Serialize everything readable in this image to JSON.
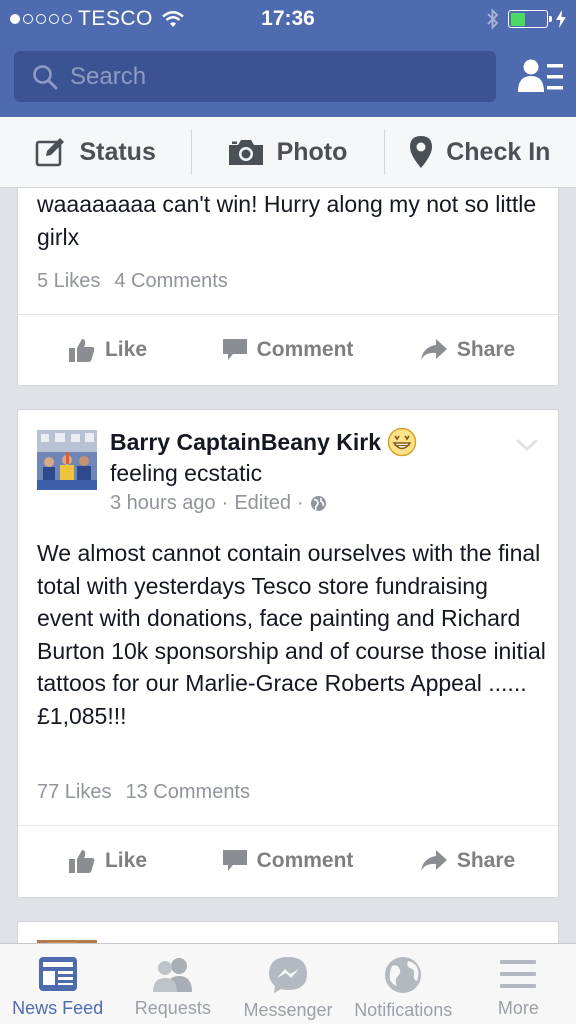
{
  "status_bar": {
    "carrier": "TESCO",
    "time": "17:36",
    "signal_bars_filled": 1,
    "signal_bars_total": 5,
    "battery_level": 0.4
  },
  "search": {
    "placeholder": "Search"
  },
  "composer": {
    "items": [
      {
        "label": "Status",
        "icon": "edit-icon"
      },
      {
        "label": "Photo",
        "icon": "camera-icon"
      },
      {
        "label": "Check In",
        "icon": "location-pin-icon"
      }
    ]
  },
  "posts": [
    {
      "text": "waaaaaaaa can't win! Hurry along my not so little girlx",
      "likes": "5 Likes",
      "comments": "4 Comments"
    },
    {
      "author": "Barry CaptainBeany Kirk",
      "feeling": "feeling ecstatic",
      "time": "3 hours ago",
      "edited": "Edited",
      "separator": "·",
      "text": "We almost cannot contain ourselves with the final total with yesterdays Tesco store fundraising event with donations, face painting and Richard Burton 10k sponsorship and of course those initial tattoos for our Marlie-Grace Roberts Appeal ......£1,085!!!",
      "likes": "77 Likes",
      "comments": "13 Comments"
    }
  ],
  "actions": {
    "like": "Like",
    "comment": "Comment",
    "share": "Share"
  },
  "tabs": [
    {
      "label": "News Feed",
      "icon": "news-feed-icon",
      "active": true
    },
    {
      "label": "Requests",
      "icon": "friend-requests-icon",
      "active": false
    },
    {
      "label": "Messenger",
      "icon": "messenger-icon",
      "active": false
    },
    {
      "label": "Notifications",
      "icon": "globe-icon",
      "active": false
    },
    {
      "label": "More",
      "icon": "menu-icon",
      "active": false
    }
  ],
  "colors": {
    "brand": "#4e6bb0",
    "search_bg": "#3b5393",
    "battery": "#4cd964",
    "tab_active": "#4e6bb0",
    "tab_inactive": "#9ba0a8"
  }
}
